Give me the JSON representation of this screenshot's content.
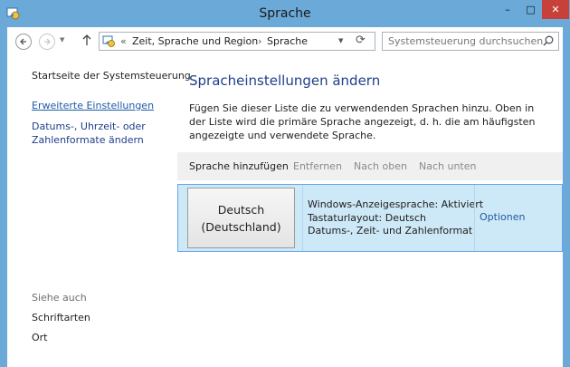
{
  "window": {
    "title": "Sprache",
    "controls": {
      "minimize": "–",
      "maximize": "□",
      "close": "✕"
    }
  },
  "nav": {
    "back_icon": "arrow-left-icon",
    "forward_icon": "arrow-right-icon",
    "up_icon": "arrow-up-icon",
    "breadcrumb": {
      "chevron": "«",
      "segment1": "Zeit, Sprache und Region",
      "separator": "›",
      "segment2": "Sprache"
    },
    "search_placeholder": "Systemsteuerung durchsuchen"
  },
  "sidebar": {
    "home": "Startseite der Systemsteuerung",
    "advanced": "Erweiterte Einstellungen",
    "date_line1": "Datums-, Uhrzeit- oder",
    "date_line2": "Zahlenformate ändern",
    "see_also": "Siehe auch",
    "fonts": "Schriftarten",
    "location": "Ort"
  },
  "main": {
    "title": "Spracheinstellungen ändern",
    "description": "Fügen Sie dieser Liste die zu verwendenden Sprachen hinzu. Oben in der Liste wird die primäre Sprache angezeigt, d. h. die am häufigsten angezeigte und verwendete Sprache.",
    "toolbar": {
      "add": "Sprache hinzufügen",
      "remove": "Entfernen",
      "move_up": "Nach oben",
      "move_down": "Nach unten"
    },
    "languages": [
      {
        "name_line1": "Deutsch",
        "name_line2": "(Deutschland)",
        "detail_line1": "Windows-Anzeigesprache: Aktiviert",
        "detail_line2": "Tastaturlayout: Deutsch",
        "detail_line3": "Datums-, Zeit- und Zahlenformat",
        "options": "Optionen"
      }
    ]
  },
  "colors": {
    "titlebar": "#6aa9d8",
    "close": "#c7413a",
    "link": "#1f5aa8",
    "selected_row": "#cde8f6"
  }
}
